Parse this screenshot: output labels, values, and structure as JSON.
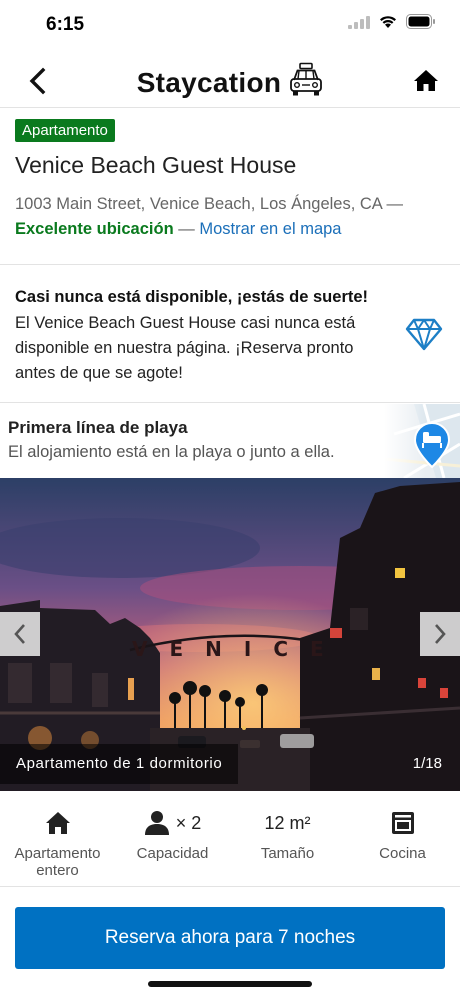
{
  "status": {
    "time": "6:15"
  },
  "nav": {
    "title": "Staycation",
    "back_icon": "chevron-left-icon",
    "title_icon": "taxi-icon",
    "home_icon": "home-icon"
  },
  "property": {
    "type_badge": "Apartamento",
    "name": "Venice Beach Guest House",
    "address": "1003 Main Street, Venice Beach, Los Ángeles, CA —",
    "location_rating": "Excelente ubicación",
    "separator": " — ",
    "map_link": "Mostrar en el mapa"
  },
  "rare_find": {
    "title": "Casi nunca está disponible, ¡estás de suerte!",
    "text": "El Venice Beach Guest House casi nunca está disponible en nuestra página. ¡Reserva pronto antes de que se agote!",
    "icon": "diamond-icon"
  },
  "beachfront": {
    "title": "Primera línea de playa",
    "text": "El alojamiento está en la playa o junto a ella.",
    "icon": "beach-pin-icon"
  },
  "photo": {
    "caption": "Apartamento de 1 dormitorio",
    "counter": "1/18",
    "sign_text": "VENICE"
  },
  "facilities": [
    {
      "icon": "house-icon",
      "label_line1": "Apartamento",
      "label_line2": "entero"
    },
    {
      "icon": "person-icon",
      "value": "× 2",
      "label_line1": "Capacidad"
    },
    {
      "value": "12 m²",
      "label_line1": "Tamaño"
    },
    {
      "icon": "oven-icon",
      "label_line1": "Cocina"
    }
  ],
  "cta": {
    "label": "Reserva ahora para 7 noches"
  },
  "colors": {
    "primary_blue": "#0071c2",
    "badge_green": "#0a7a1e",
    "link_blue": "#1b6fb9"
  }
}
